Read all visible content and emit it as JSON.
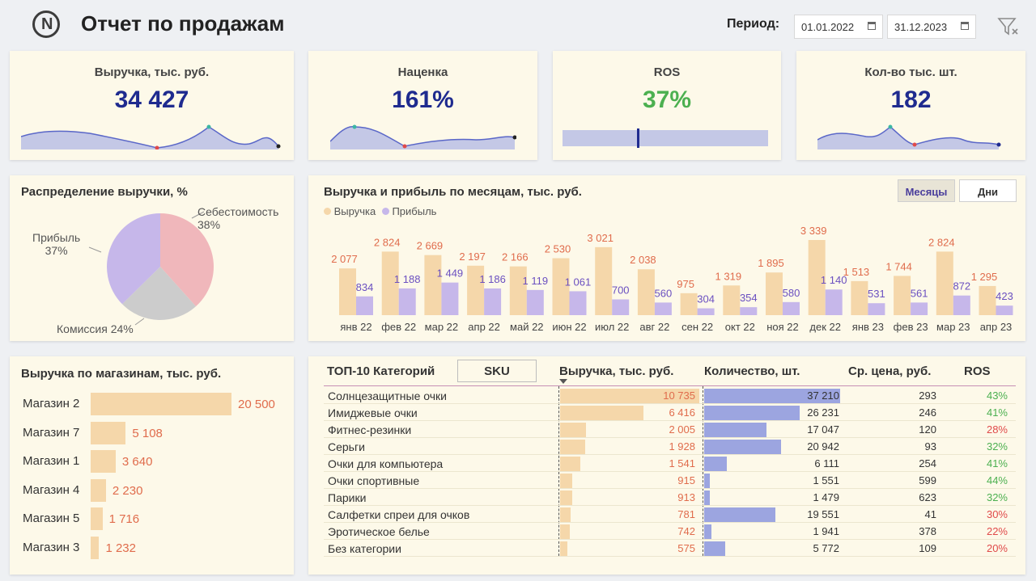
{
  "header": {
    "title": "Отчет по продажам",
    "period_label": "Период:",
    "date_from": "01.01.2022",
    "date_to": "31.12.2023"
  },
  "kpis": [
    {
      "title": "Выручка, тыс. руб.",
      "value": "34 427"
    },
    {
      "title": "Наценка",
      "value": "161%"
    },
    {
      "title": "ROS",
      "value": "37%",
      "gauge_fraction": 0.37
    },
    {
      "title": "Кол-во тыс. шт.",
      "value": "182"
    }
  ],
  "pie": {
    "title": "Распределение выручки, %",
    "slices": [
      {
        "label": "Себестоимость",
        "pct": "38%",
        "value": 38,
        "color": "#f0b7bb"
      },
      {
        "label": "Комиссия",
        "pct": "24%",
        "value": 24,
        "color": "#cccccc"
      },
      {
        "label": "Прибыль",
        "pct": "37%",
        "value": 37,
        "color": "#c6b7ea"
      }
    ]
  },
  "monthly": {
    "title": "Выручка и прибыль по месяцам, тыс. руб.",
    "btn_months": "Месяцы",
    "btn_days": "Дни"
  },
  "chart_data": {
    "type": "bar",
    "categories": [
      "янв 22",
      "фев 22",
      "мар 22",
      "апр 22",
      "май 22",
      "июн 22",
      "июл 22",
      "авг 22",
      "сен 22",
      "окт 22",
      "ноя 22",
      "дек 22",
      "янв 23",
      "фев 23",
      "мар 23",
      "апр 23"
    ],
    "series": [
      {
        "name": "Выручка",
        "color": "#f5d7aa",
        "label_color": "#e06c4c",
        "values": [
          2077,
          2824,
          2669,
          2197,
          2166,
          2530,
          3021,
          2038,
          975,
          1319,
          1895,
          3339,
          1513,
          1744,
          2824,
          1295
        ]
      },
      {
        "name": "Прибыль",
        "color": "#c6b7ea",
        "label_color": "#6a4fc0",
        "values": [
          834,
          1188,
          1449,
          1186,
          1119,
          1061,
          700,
          560,
          304,
          354,
          580,
          1140,
          531,
          561,
          872,
          423
        ]
      }
    ]
  },
  "stores": {
    "title": "Выручка по магазинам, тыс. руб.",
    "items": [
      {
        "name": "Магазин 2",
        "value": 20500,
        "label": "20 500"
      },
      {
        "name": "Магазин 7",
        "value": 5108,
        "label": "5 108"
      },
      {
        "name": "Магазин 1",
        "value": 3640,
        "label": "3 640"
      },
      {
        "name": "Магазин 4",
        "value": 2230,
        "label": "2 230"
      },
      {
        "name": "Магазин 5",
        "value": 1716,
        "label": "1 716"
      },
      {
        "name": "Магазин 3",
        "value": 1232,
        "label": "1 232"
      }
    ]
  },
  "table": {
    "title": "ТОП-10 Категорий",
    "sku_button": "SKU",
    "col_revenue": "Выручка, тыс. руб.",
    "col_qty": "Количество, шт.",
    "col_price": "Ср. цена, руб.",
    "col_ros": "ROS",
    "rows": [
      {
        "cat": "Солнцезащитные очки",
        "rev": 10735,
        "rev_label": "10 735",
        "qty": 37210,
        "qty_label": "37 210",
        "price": "293",
        "ros": "43%",
        "ros_good": true
      },
      {
        "cat": "Имиджевые очки",
        "rev": 6416,
        "rev_label": "6 416",
        "qty": 26231,
        "qty_label": "26 231",
        "price": "246",
        "ros": "41%",
        "ros_good": true
      },
      {
        "cat": "Фитнес-резинки",
        "rev": 2005,
        "rev_label": "2 005",
        "qty": 17047,
        "qty_label": "17 047",
        "price": "120",
        "ros": "28%",
        "ros_good": false
      },
      {
        "cat": "Серьги",
        "rev": 1928,
        "rev_label": "1 928",
        "qty": 20942,
        "qty_label": "20 942",
        "price": "93",
        "ros": "32%",
        "ros_good": true
      },
      {
        "cat": "Очки для компьютера",
        "rev": 1541,
        "rev_label": "1 541",
        "qty": 6111,
        "qty_label": "6 111",
        "price": "254",
        "ros": "41%",
        "ros_good": true
      },
      {
        "cat": "Очки спортивные",
        "rev": 915,
        "rev_label": "915",
        "qty": 1551,
        "qty_label": "1 551",
        "price": "599",
        "ros": "44%",
        "ros_good": true
      },
      {
        "cat": "Парики",
        "rev": 913,
        "rev_label": "913",
        "qty": 1479,
        "qty_label": "1 479",
        "price": "623",
        "ros": "32%",
        "ros_good": true
      },
      {
        "cat": "Салфетки спреи для очков",
        "rev": 781,
        "rev_label": "781",
        "qty": 19551,
        "qty_label": "19 551",
        "price": "41",
        "ros": "30%",
        "ros_good": false
      },
      {
        "cat": "Эротическое белье",
        "rev": 742,
        "rev_label": "742",
        "qty": 1941,
        "qty_label": "1 941",
        "price": "378",
        "ros": "22%",
        "ros_good": false
      },
      {
        "cat": "Без категории",
        "rev": 575,
        "rev_label": "575",
        "qty": 5772,
        "qty_label": "5 772",
        "price": "109",
        "ros": "20%",
        "ros_good": false
      }
    ]
  }
}
